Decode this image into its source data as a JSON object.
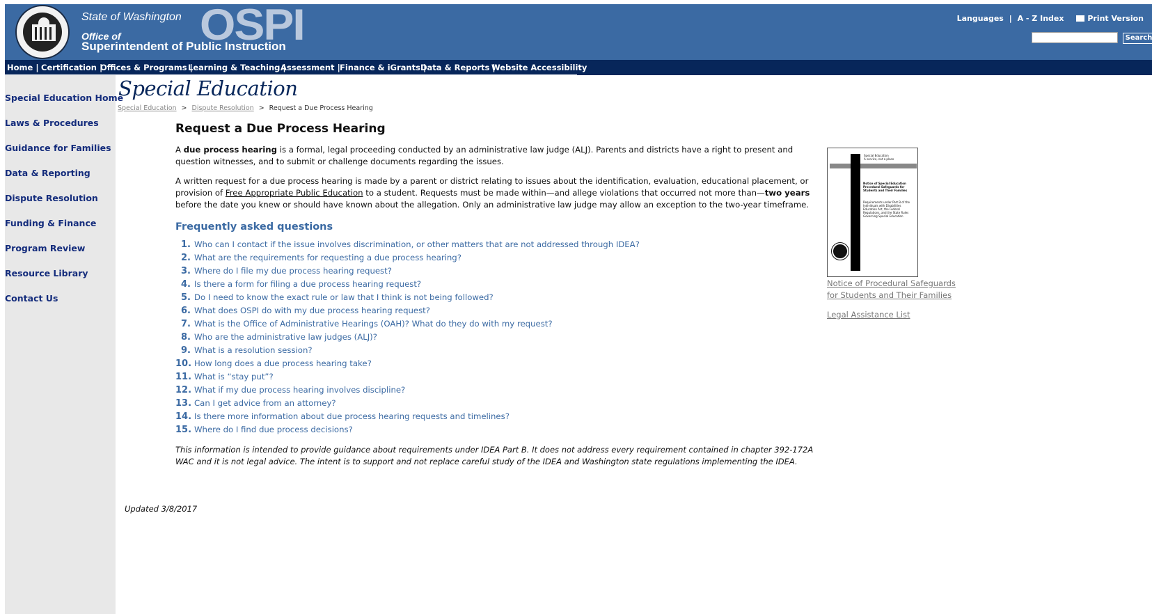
{
  "header": {
    "state": "State of Washington",
    "logo_text": "OSPI",
    "office_line": "Office of",
    "superintendent_line": "Superintendent of Public Instruction",
    "languages": "Languages",
    "az_index": "A - Z Index",
    "print_version": "Print Version",
    "search_placeholder": "",
    "search_button": "Search",
    "divider": "|"
  },
  "nav": {
    "items": [
      "Home",
      "Certification",
      "Offices & Programs",
      "Learning & Teaching",
      "Assessment",
      "Finance & iGrants",
      "Data & Reports",
      "Website Accessibility"
    ],
    "separator": "|"
  },
  "sidebar": {
    "items": [
      "Special Education Home",
      "Laws & Procedures",
      "Guidance for Families",
      "Data & Reporting",
      "Dispute Resolution",
      "Funding & Finance",
      "Program Review",
      "Resource Library",
      "Contact Us"
    ]
  },
  "section_title": "Special Education",
  "breadcrumb": {
    "items": [
      "Special Education",
      "Dispute Resolution",
      "Request a Due Process Hearing"
    ],
    "separator": ">"
  },
  "main": {
    "title": "Request a Due Process Hearing",
    "intro": {
      "p1_a": "A ",
      "p1_bold": "due process hearing",
      "p1_b": " is a formal, legal proceeding conducted by an administrative law judge (ALJ). Parents and districts have a right to present and question witnesses, and to submit or challenge documents regarding the issues.",
      "p2_a": "A written request for a due process hearing is made by a parent or district relating to issues about the identification, evaluation, educational placement, or provision of ",
      "p2_link": "Free Appropriate Public Education",
      "p2_b": " to a student. Requests must be made within—and allege violations that occurred not more than—",
      "p2_bold": "two years",
      "p2_c": " before the date you knew or should have known about the allegation. Only an administrative law judge may allow an exception to the two-year timeframe."
    },
    "faq_heading": "Frequently asked questions",
    "faq": [
      {
        "num": "1.",
        "q": "Who can I contact if the issue involves discrimination, or other matters that are not addressed through IDEA?"
      },
      {
        "num": "2.",
        "q": "What are the requirements for requesting a due process hearing?"
      },
      {
        "num": "3.",
        "q": "Where do I file my due process hearing request?"
      },
      {
        "num": "4.",
        "q": "Is there a form for filing a due process hearing request?"
      },
      {
        "num": "5.",
        "q": "Do I need to know the exact rule or law that I think is not being followed?"
      },
      {
        "num": "6.",
        "q": "What does OSPI do with my due process hearing request?"
      },
      {
        "num": "7.",
        "q": "What is the Office of Administrative Hearings (OAH)? What do they do with my request?"
      },
      {
        "num": "8.",
        "q": "Who are the administrative law judges (ALJ)?"
      },
      {
        "num": "9.",
        "q": "What is a resolution session?"
      },
      {
        "num": "10.",
        "q": "How long does a due process hearing take?"
      },
      {
        "num": "11.",
        "q": "What is “stay put”?"
      },
      {
        "num": "12.",
        "q": "What if my due process hearing involves discipline?"
      },
      {
        "num": "13.",
        "q": "Can I get advice from an attorney?"
      },
      {
        "num": "14.",
        "q": "Is there more information about due process hearing requests and timelines?"
      },
      {
        "num": "15.",
        "q": "Where do I find due process decisions?"
      }
    ],
    "disclaimer": "This information is intended to provide guidance about requirements under IDEA Part B. It does not address every requirement contained in chapter 392-172A WAC and it is not legal advice. The intent is to support and not replace careful study of the IDEA and Washington state regulations implementing the IDEA.",
    "updated": "Updated 3/8/2017"
  },
  "right_panel": {
    "thumb_text": {
      "top": "Special Education",
      "top2": "A service, not a place",
      "title": "Notice of Special Education Procedural Safeguards for Students and Their Families",
      "body": "Requirements under Part B of the Individuals with Disabilities Education Act, the Federal Regulations, and the State Rules Governing Special Education"
    },
    "link1_line1": "Notice of Procedural Safeguards",
    "link1_line2": "for Students and Their Families",
    "link2": "Legal Assistance List"
  }
}
